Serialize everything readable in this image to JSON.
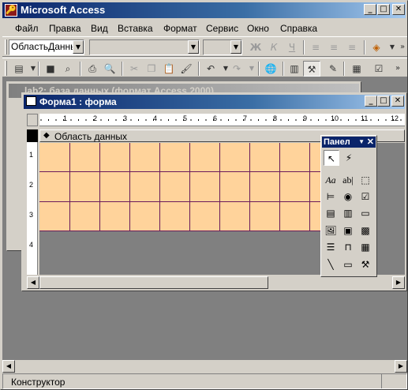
{
  "app": {
    "title": "Microsoft Access"
  },
  "menu": [
    "Файл",
    "Правка",
    "Вид",
    "Вставка",
    "Формат",
    "Сервис",
    "Окно",
    "Справка"
  ],
  "toolbar1": {
    "object_combo": "ОбластьДанны",
    "font_combo": "",
    "size_combo": ""
  },
  "db_window": {
    "title": "lab2: база данных (формат Access 2000)"
  },
  "form_window": {
    "title": "Форма1 : форма",
    "section_label": "Область данных"
  },
  "ruler_h": [
    "1",
    "2",
    "3",
    "4",
    "5",
    "6",
    "7",
    "8",
    "9",
    "10",
    "11",
    "12"
  ],
  "ruler_v": [
    "1",
    "2",
    "3",
    "4"
  ],
  "toolbox": {
    "title": "Панел"
  },
  "status": {
    "text": "Конструктор"
  },
  "colors": {
    "title_bar": "#0a246a",
    "detail_section": "#ffd39b",
    "grid_lines": "#6a1a5a",
    "workspace": "#808080"
  }
}
